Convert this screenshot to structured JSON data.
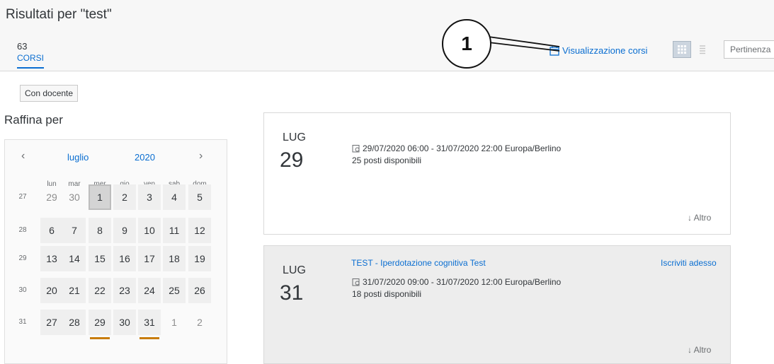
{
  "header": {
    "title": "Risultati per \"test\"",
    "count": "63",
    "tab_label": "CORSI",
    "view_courses_label": "Visualizzazione corsi",
    "sort_value": "Pertinenza"
  },
  "filters": {
    "chip_label": "Con docente",
    "refine_label": "Raffina per"
  },
  "calendar": {
    "month": "luglio",
    "year": "2020",
    "prev": "‹",
    "next": "›",
    "weekdays": [
      "lun",
      "mar",
      "mer",
      "gio",
      "ven",
      "sab",
      "dom"
    ],
    "weeks": [
      {
        "num": "27",
        "days": [
          {
            "d": "29",
            "other": true
          },
          {
            "d": "30",
            "other": true
          },
          {
            "d": "1",
            "today": true
          },
          {
            "d": "2"
          },
          {
            "d": "3"
          },
          {
            "d": "4"
          },
          {
            "d": "5"
          }
        ]
      },
      {
        "num": "28",
        "days": [
          {
            "d": "6"
          },
          {
            "d": "7"
          },
          {
            "d": "8"
          },
          {
            "d": "9"
          },
          {
            "d": "10"
          },
          {
            "d": "11"
          },
          {
            "d": "12"
          }
        ]
      },
      {
        "num": "29",
        "days": [
          {
            "d": "13"
          },
          {
            "d": "14"
          },
          {
            "d": "15"
          },
          {
            "d": "16"
          },
          {
            "d": "17"
          },
          {
            "d": "18"
          },
          {
            "d": "19"
          }
        ]
      },
      {
        "num": "30",
        "days": [
          {
            "d": "20"
          },
          {
            "d": "21"
          },
          {
            "d": "22"
          },
          {
            "d": "23"
          },
          {
            "d": "24"
          },
          {
            "d": "25"
          },
          {
            "d": "26"
          }
        ]
      },
      {
        "num": "31",
        "days": [
          {
            "d": "27"
          },
          {
            "d": "28"
          },
          {
            "d": "29",
            "marked": true
          },
          {
            "d": "30"
          },
          {
            "d": "31",
            "marked": true
          },
          {
            "d": "1",
            "other": true
          },
          {
            "d": "2",
            "other": true
          }
        ]
      }
    ]
  },
  "results": [
    {
      "month": "LUG",
      "day": "29",
      "title": "",
      "datetime": "29/07/2020 06:00 - 31/07/2020 22:00 Europa/Berlino",
      "seats": "25 posti disponibili",
      "action": "",
      "more": "Altro"
    },
    {
      "month": "LUG",
      "day": "31",
      "title": "TEST - Iperdotazione cognitiva Test",
      "datetime": "31/07/2020 09:00 - 31/07/2020 12:00 Europa/Berlino",
      "seats": "18 posti disponibili",
      "action": "Iscriviti adesso",
      "more": "Altro"
    }
  ],
  "annotation": {
    "number": "1"
  },
  "colors": {
    "accent": "#0a6ed1",
    "marker": "#c87c0a",
    "selected_card_bg": "#ededed"
  }
}
